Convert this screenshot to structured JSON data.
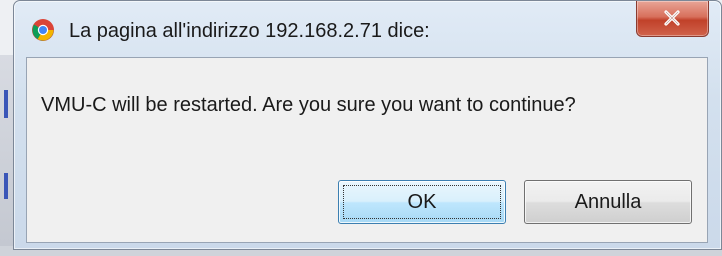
{
  "dialog": {
    "title": "La pagina all'indirizzo 192.168.2.71 dice:",
    "app_icon": "chrome-icon",
    "close_icon": "close-icon",
    "message": "VMU-C will be restarted. Are you sure you want to continue?",
    "buttons": {
      "ok_label": "OK",
      "cancel_label": "Annulla"
    },
    "colors": {
      "titlebar": "#d3e0ee",
      "close_button": "#c1412a",
      "default_button_border": "#3c7fb1"
    }
  }
}
